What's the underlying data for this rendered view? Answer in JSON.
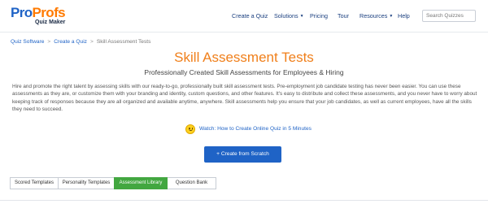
{
  "brand": {
    "logo_pro": "Pro",
    "logo_profs": "Profs",
    "logo_sub": "Quiz Maker"
  },
  "nav": {
    "items": [
      {
        "label": "Create a Quiz",
        "dropdown": false
      },
      {
        "label": "Solutions",
        "dropdown": true
      },
      {
        "label": "Pricing",
        "dropdown": false
      },
      {
        "label": "Tour",
        "dropdown": false
      },
      {
        "label": "Resources",
        "dropdown": true
      },
      {
        "label": "Help",
        "dropdown": false
      }
    ],
    "search_placeholder": "Search Quizzes"
  },
  "breadcrumb": {
    "items": [
      "Quiz Software",
      "Create a Quiz",
      "Skill Assessment Tests"
    ],
    "separator": ">"
  },
  "page": {
    "title": "Skill Assessment Tests",
    "subtitle": "Professionally Created Skill Assessments for Employees & Hiring",
    "description": "Hire and promote the right talent by assessing skills with our ready-to-go, professionally built skill assessment tests. Pre-employment job candidate testing has never been easier. You can use these assessments as they are, or customize them with your branding and identity, custom questions, and other features. It's easy to distribute and collect these assessments, and you never have to worry about keeping track of responses because they are all organized and available anytime, anywhere. Skill assessments help you ensure that your job candidates, as well as current employees, have all the skills they need to succeed.",
    "watch_label": "Watch: How to Create Online Quiz in 5 Minutes",
    "create_button": "+ Create from Scratch"
  },
  "tabs": {
    "items": [
      {
        "label": "Scored Templates",
        "active": false
      },
      {
        "label": "Personality Templates",
        "active": false
      },
      {
        "label": "Assessment Library",
        "active": true
      },
      {
        "label": "Question Bank",
        "active": false
      }
    ]
  },
  "colors": {
    "brand_blue": "#1f63c6",
    "brand_orange": "#f07f1a",
    "active_tab": "#42a740"
  }
}
